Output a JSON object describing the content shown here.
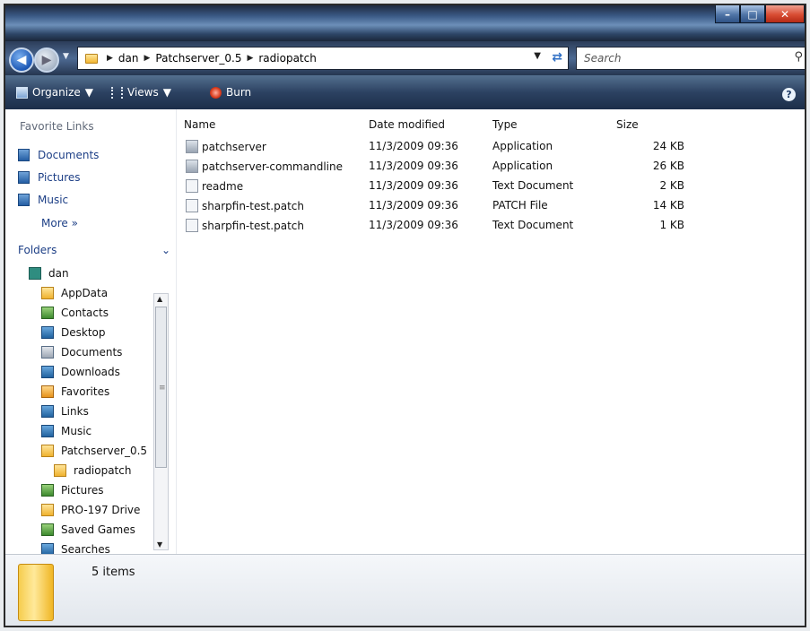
{
  "address": {
    "crumbs": [
      "dan",
      "Patchserver_0.5",
      "radiopatch"
    ]
  },
  "search": {
    "placeholder": "Search"
  },
  "toolbar": {
    "organize": "Organize",
    "views": "Views",
    "burn": "Burn"
  },
  "nav": {
    "favorites_header": "Favorite Links",
    "favorites": [
      "Documents",
      "Pictures",
      "Music"
    ],
    "more": "More",
    "folders_header": "Folders",
    "tree": [
      "dan",
      "AppData",
      "Contacts",
      "Desktop",
      "Documents",
      "Downloads",
      "Favorites",
      "Links",
      "Music",
      "Patchserver_0.5",
      "radiopatch",
      "Pictures",
      "PRO-197 Drive",
      "Saved Games",
      "Searches"
    ]
  },
  "columns": {
    "name": "Name",
    "date": "Date modified",
    "type": "Type",
    "size": "Size"
  },
  "files": [
    {
      "name": "patchserver",
      "date": "11/3/2009 09:36",
      "type": "Application",
      "size": "24 KB",
      "icon": "application-icon"
    },
    {
      "name": "patchserver-commandline",
      "date": "11/3/2009 09:36",
      "type": "Application",
      "size": "26 KB",
      "icon": "application-icon"
    },
    {
      "name": "readme",
      "date": "11/3/2009 09:36",
      "type": "Text Document",
      "size": "2 KB",
      "icon": "document-icon"
    },
    {
      "name": "sharpfin-test.patch",
      "date": "11/3/2009 09:36",
      "type": "PATCH File",
      "size": "14 KB",
      "icon": "document-icon"
    },
    {
      "name": "sharpfin-test.patch",
      "date": "11/3/2009 09:36",
      "type": "Text Document",
      "size": "1 KB",
      "icon": "document-icon"
    }
  ],
  "details": {
    "count": "5 items"
  }
}
